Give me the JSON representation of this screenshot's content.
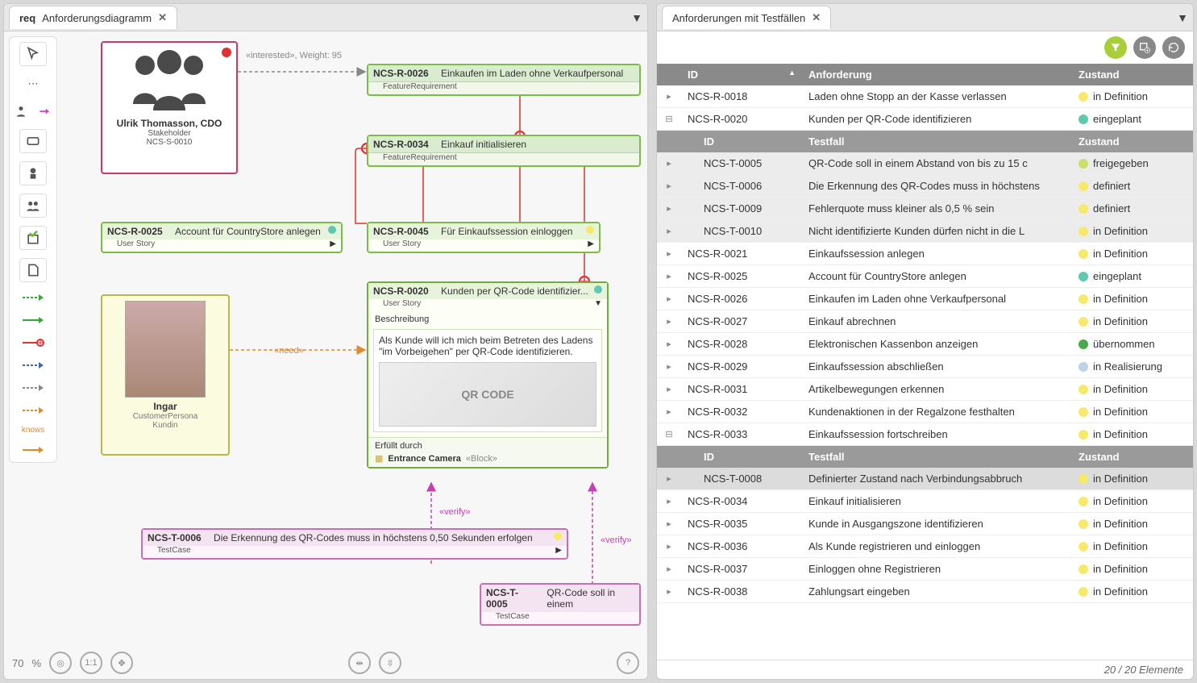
{
  "tabs": {
    "left_prefix": "req",
    "left_title": "Anforderungsdiagramm",
    "right_title": "Anforderungen mit Testfällen"
  },
  "toolbar_labels": {
    "knows": "knows"
  },
  "edge_labels": {
    "interested": "«interested», Weight:  95",
    "need": "«need»",
    "verify1": "«verify»",
    "verify2": "«verify»"
  },
  "stakeholder": {
    "name": "Ulrik Thomasson, CDO",
    "role": "Stakeholder",
    "id": "NCS-S-0010"
  },
  "nodes": {
    "r0026": {
      "id": "NCS-R-0026",
      "title": "Einkaufen im Laden ohne Verkaufpersonal",
      "type": "FeatureRequirement"
    },
    "r0034": {
      "id": "NCS-R-0034",
      "title": "Einkauf initialisieren",
      "type": "FeatureRequirement"
    },
    "r0025": {
      "id": "NCS-R-0025",
      "title": "Account für CountryStore anlegen",
      "type": "User Story"
    },
    "r0045": {
      "id": "NCS-R-0045",
      "title": "Für Einkaufssession einloggen",
      "type": "User Story"
    },
    "r0020": {
      "id": "NCS-R-0020",
      "title": "Kunden per QR-Code identifizier...",
      "type": "User Story",
      "desc_label": "Beschreibung",
      "desc": "Als Kunde will ich mich beim Betreten des Ladens \"im Vorbeigehen\" per QR-Code identifizieren.",
      "img_text": "QR CODE",
      "fulfill_label": "Erfüllt durch",
      "fulfill_item": "Entrance Camera",
      "fulfill_stereo": "«Block»"
    },
    "t0006": {
      "id": "NCS-T-0006",
      "title": "Die Erkennung des QR-Codes muss in höchstens 0,50 Sekunden erfolgen",
      "type": "TestCase"
    },
    "t0005": {
      "id": "NCS-T-0005",
      "title": "QR-Code soll in einem",
      "type": "TestCase"
    }
  },
  "persona": {
    "name": "Ingar",
    "role": "CustomerPersona",
    "sub": "Kundin"
  },
  "footer": {
    "zoom": "70",
    "pct": "%"
  },
  "grid": {
    "headers": {
      "id": "ID",
      "req": "Anforderung",
      "state": "Zustand",
      "tc": "Testfall"
    },
    "rows": [
      {
        "id": "NCS-R-0018",
        "txt": "Laden ohne Stopp an der Kasse verlassen",
        "state": "in Definition",
        "dot": "sd-yellow"
      },
      {
        "id": "NCS-R-0020",
        "txt": "Kunden per QR-Code identifizieren",
        "state": "eingeplant",
        "dot": "sd-teal",
        "expanded": true,
        "children": [
          {
            "id": "NCS-T-0005",
            "txt": "QR-Code soll in einem Abstand von bis zu 15 c",
            "state": "freigegeben",
            "dot": "sd-lime"
          },
          {
            "id": "NCS-T-0006",
            "txt": "Die Erkennung des QR-Codes muss in höchstens",
            "state": "definiert",
            "dot": "sd-yellow"
          },
          {
            "id": "NCS-T-0009",
            "txt": "Fehlerquote muss kleiner als 0,5 % sein",
            "state": "definiert",
            "dot": "sd-yellow"
          },
          {
            "id": "NCS-T-0010",
            "txt": "Nicht identifizierte Kunden dürfen nicht in die L",
            "state": "in Definition",
            "dot": "sd-yellow"
          }
        ]
      },
      {
        "id": "NCS-R-0021",
        "txt": "Einkaufssession anlegen",
        "state": "in Definition",
        "dot": "sd-yellow"
      },
      {
        "id": "NCS-R-0025",
        "txt": "Account für CountryStore anlegen",
        "state": "eingeplant",
        "dot": "sd-teal"
      },
      {
        "id": "NCS-R-0026",
        "txt": "Einkaufen im Laden ohne Verkaufpersonal",
        "state": "in Definition",
        "dot": "sd-yellow"
      },
      {
        "id": "NCS-R-0027",
        "txt": "Einkauf abrechnen",
        "state": "in Definition",
        "dot": "sd-yellow"
      },
      {
        "id": "NCS-R-0028",
        "txt": "Elektronischen Kassenbon anzeigen",
        "state": "übernommen",
        "dot": "sd-green"
      },
      {
        "id": "NCS-R-0029",
        "txt": "Einkaufssession abschließen",
        "state": "in Realisierung",
        "dot": "sd-blue"
      },
      {
        "id": "NCS-R-0031",
        "txt": "Artikelbewegungen erkennen",
        "state": "in Definition",
        "dot": "sd-yellow"
      },
      {
        "id": "NCS-R-0032",
        "txt": "Kundenaktionen in der Regalzone festhalten",
        "state": "in Definition",
        "dot": "sd-yellow"
      },
      {
        "id": "NCS-R-0033",
        "txt": "Einkaufssession fortschreiben",
        "state": "in Definition",
        "dot": "sd-yellow",
        "expanded": true,
        "children": [
          {
            "id": "NCS-T-0008",
            "txt": "Definierter Zustand nach Verbindungsabbruch",
            "state": "in Definition",
            "dot": "sd-yellow",
            "sel": true
          }
        ]
      },
      {
        "id": "NCS-R-0034",
        "txt": "Einkauf initialisieren",
        "state": "in Definition",
        "dot": "sd-yellow"
      },
      {
        "id": "NCS-R-0035",
        "txt": "Kunde in Ausgangszone identifizieren",
        "state": "in Definition",
        "dot": "sd-yellow"
      },
      {
        "id": "NCS-R-0036",
        "txt": "Als Kunde registrieren und einloggen",
        "state": "in Definition",
        "dot": "sd-yellow"
      },
      {
        "id": "NCS-R-0037",
        "txt": "Einloggen ohne Registrieren",
        "state": "in Definition",
        "dot": "sd-yellow"
      },
      {
        "id": "NCS-R-0038",
        "txt": "Zahlungsart eingeben",
        "state": "in Definition",
        "dot": "sd-yellow"
      }
    ],
    "footer": "20 / 20 Elemente"
  }
}
